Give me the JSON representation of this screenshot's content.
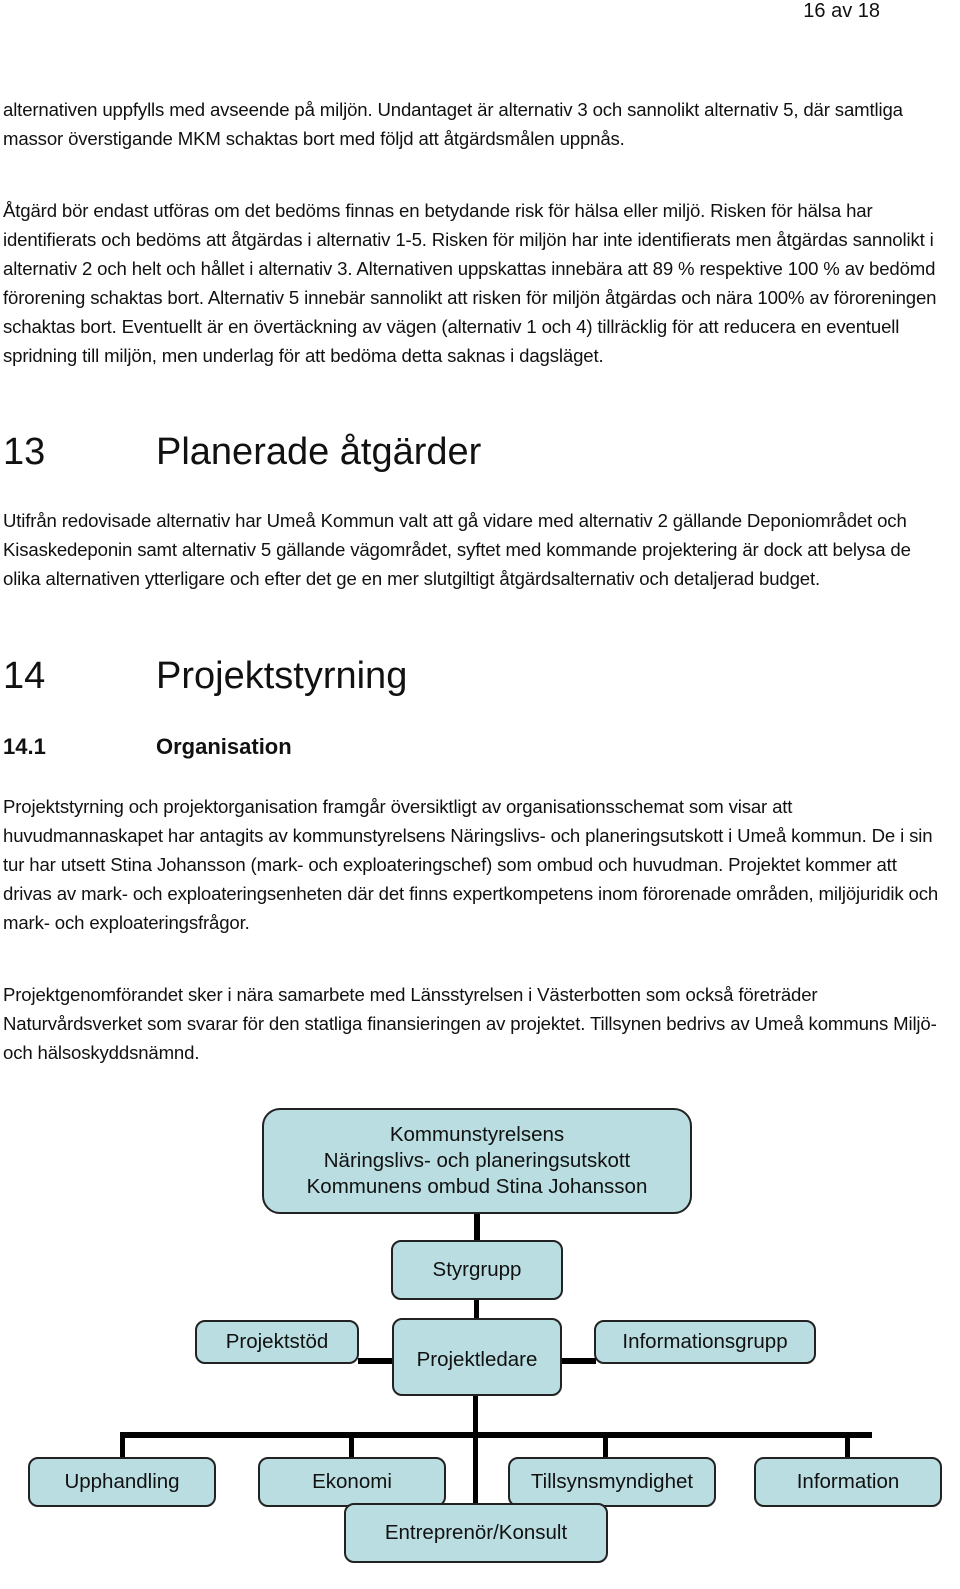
{
  "page_header": {
    "page_number": "16 av 18"
  },
  "paragraphs": {
    "p1": "alternativen uppfylls med avseende på miljön. Undantaget är alternativ 3 och sannolikt alternativ 5, där samtliga massor överstigande MKM schaktas bort med följd att åtgärdsmålen uppnås.",
    "p2": "Åtgärd bör endast utföras om det bedöms finnas en betydande risk för hälsa eller miljö. Risken för hälsa har identifierats och bedöms att åtgärdas i alternativ 1-5. Risken för miljön har inte identifierats men åtgärdas sannolikt i alternativ 2 och helt och hållet i alternativ 3. Alternativen uppskattas innebära att 89 % respektive 100 % av bedömd förorening schaktas bort. Alternativ 5 innebär sannolikt att risken för miljön åtgärdas och nära 100% av föroreningen schaktas bort. Eventuellt är en övertäckning av vägen (alternativ 1 och 4) tillräcklig för att reducera en eventuell spridning till miljön, men underlag för att bedöma detta saknas i dagsläget.",
    "p3": "Utifrån redovisade alternativ har Umeå Kommun valt att gå vidare med alternativ 2 gällande Deponiområdet och Kisaskedeponin samt alternativ 5 gällande vägområdet, syftet med kommande projektering är dock att belysa de olika alternativen ytterligare och efter det ge en mer slutgiltigt åtgärdsalternativ och detaljerad budget.",
    "p4": "Projektstyrning och projektorganisation framgår översiktligt av organisationsschemat som visar att huvudmannaskapet har antagits av kommunstyrelsens Näringslivs- och planeringsutskott i Umeå kommun. De i sin tur har utsett Stina Johansson (mark- och exploateringschef) som ombud och huvudman. Projektet kommer att drivas av mark- och exploateringsenheten där det finns expertkompetens inom förorenade områden, miljöjuridik och mark- och exploateringsfrågor.",
    "p5": "Projektgenomförandet sker i nära samarbete med Länsstyrelsen i Västerbotten som också företräder Naturvårdsverket som svarar för den statliga finansieringen av projektet. Tillsynen bedrivs av Umeå kommuns Miljö- och hälsoskyddsnämnd."
  },
  "headings": {
    "h13": {
      "number": "13",
      "title": "Planerade åtgärder"
    },
    "h14": {
      "number": "14",
      "title": "Projektstyrning"
    },
    "h14_1": {
      "number": "14.1",
      "title": "Organisation"
    }
  },
  "org_chart": {
    "colors": {
      "box_fill": "#b9dde0",
      "box_border": "#222222",
      "connector": "#000000"
    },
    "top": {
      "line1": "Kommunstyrelsens",
      "line2": "Näringslivs- och planeringsutskott",
      "line3": "Kommunens ombud Stina Johansson"
    },
    "styrgrupp": "Styrgrupp",
    "projektstod": "Projektstöd",
    "projektledare": "Projektledare",
    "informationsgrupp": "Informationsgrupp",
    "upphandling": "Upphandling",
    "ekonomi": "Ekonomi",
    "tillsynsmyndighet": "Tillsynsmyndighet",
    "information": "Information",
    "entreprenor": "Entreprenör/Konsult"
  }
}
